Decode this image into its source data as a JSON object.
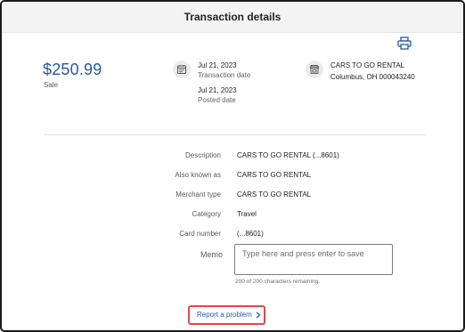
{
  "header": {
    "title": "Transaction details"
  },
  "summary": {
    "amount": "$250.99",
    "amount_type": "Sale"
  },
  "dates": {
    "transaction_date": "Jul 21, 2023",
    "transaction_label": "Transaction date",
    "posted_date": "Jul 21, 2023",
    "posted_label": "Posted date"
  },
  "merchant": {
    "name": "CARS TO GO RENTAL",
    "location": "Columbus, OH 000043240"
  },
  "details": [
    {
      "label": "Description",
      "value": "CARS TO GO RENTAL (...8601)"
    },
    {
      "label": "Also known as",
      "value": "CARS TO GO RENTAL"
    },
    {
      "label": "Merchant type",
      "value": "CARS TO GO RENTAL"
    },
    {
      "label": "Category",
      "value": "Travel"
    },
    {
      "label": "Card number",
      "value": "(...8601)"
    }
  ],
  "memo": {
    "label": "Memo",
    "placeholder": "Type here and press enter to save",
    "value": "",
    "remaining": "200 of 200 characters remaining."
  },
  "report": {
    "label": "Report a problem"
  },
  "icons": {
    "print": "printer-icon",
    "date": "calendar-icon",
    "merchant": "storefront-icon",
    "report": "chevron-right-icon"
  },
  "colors": {
    "accent": "#2a5a9e",
    "highlight": "#e0484a"
  }
}
